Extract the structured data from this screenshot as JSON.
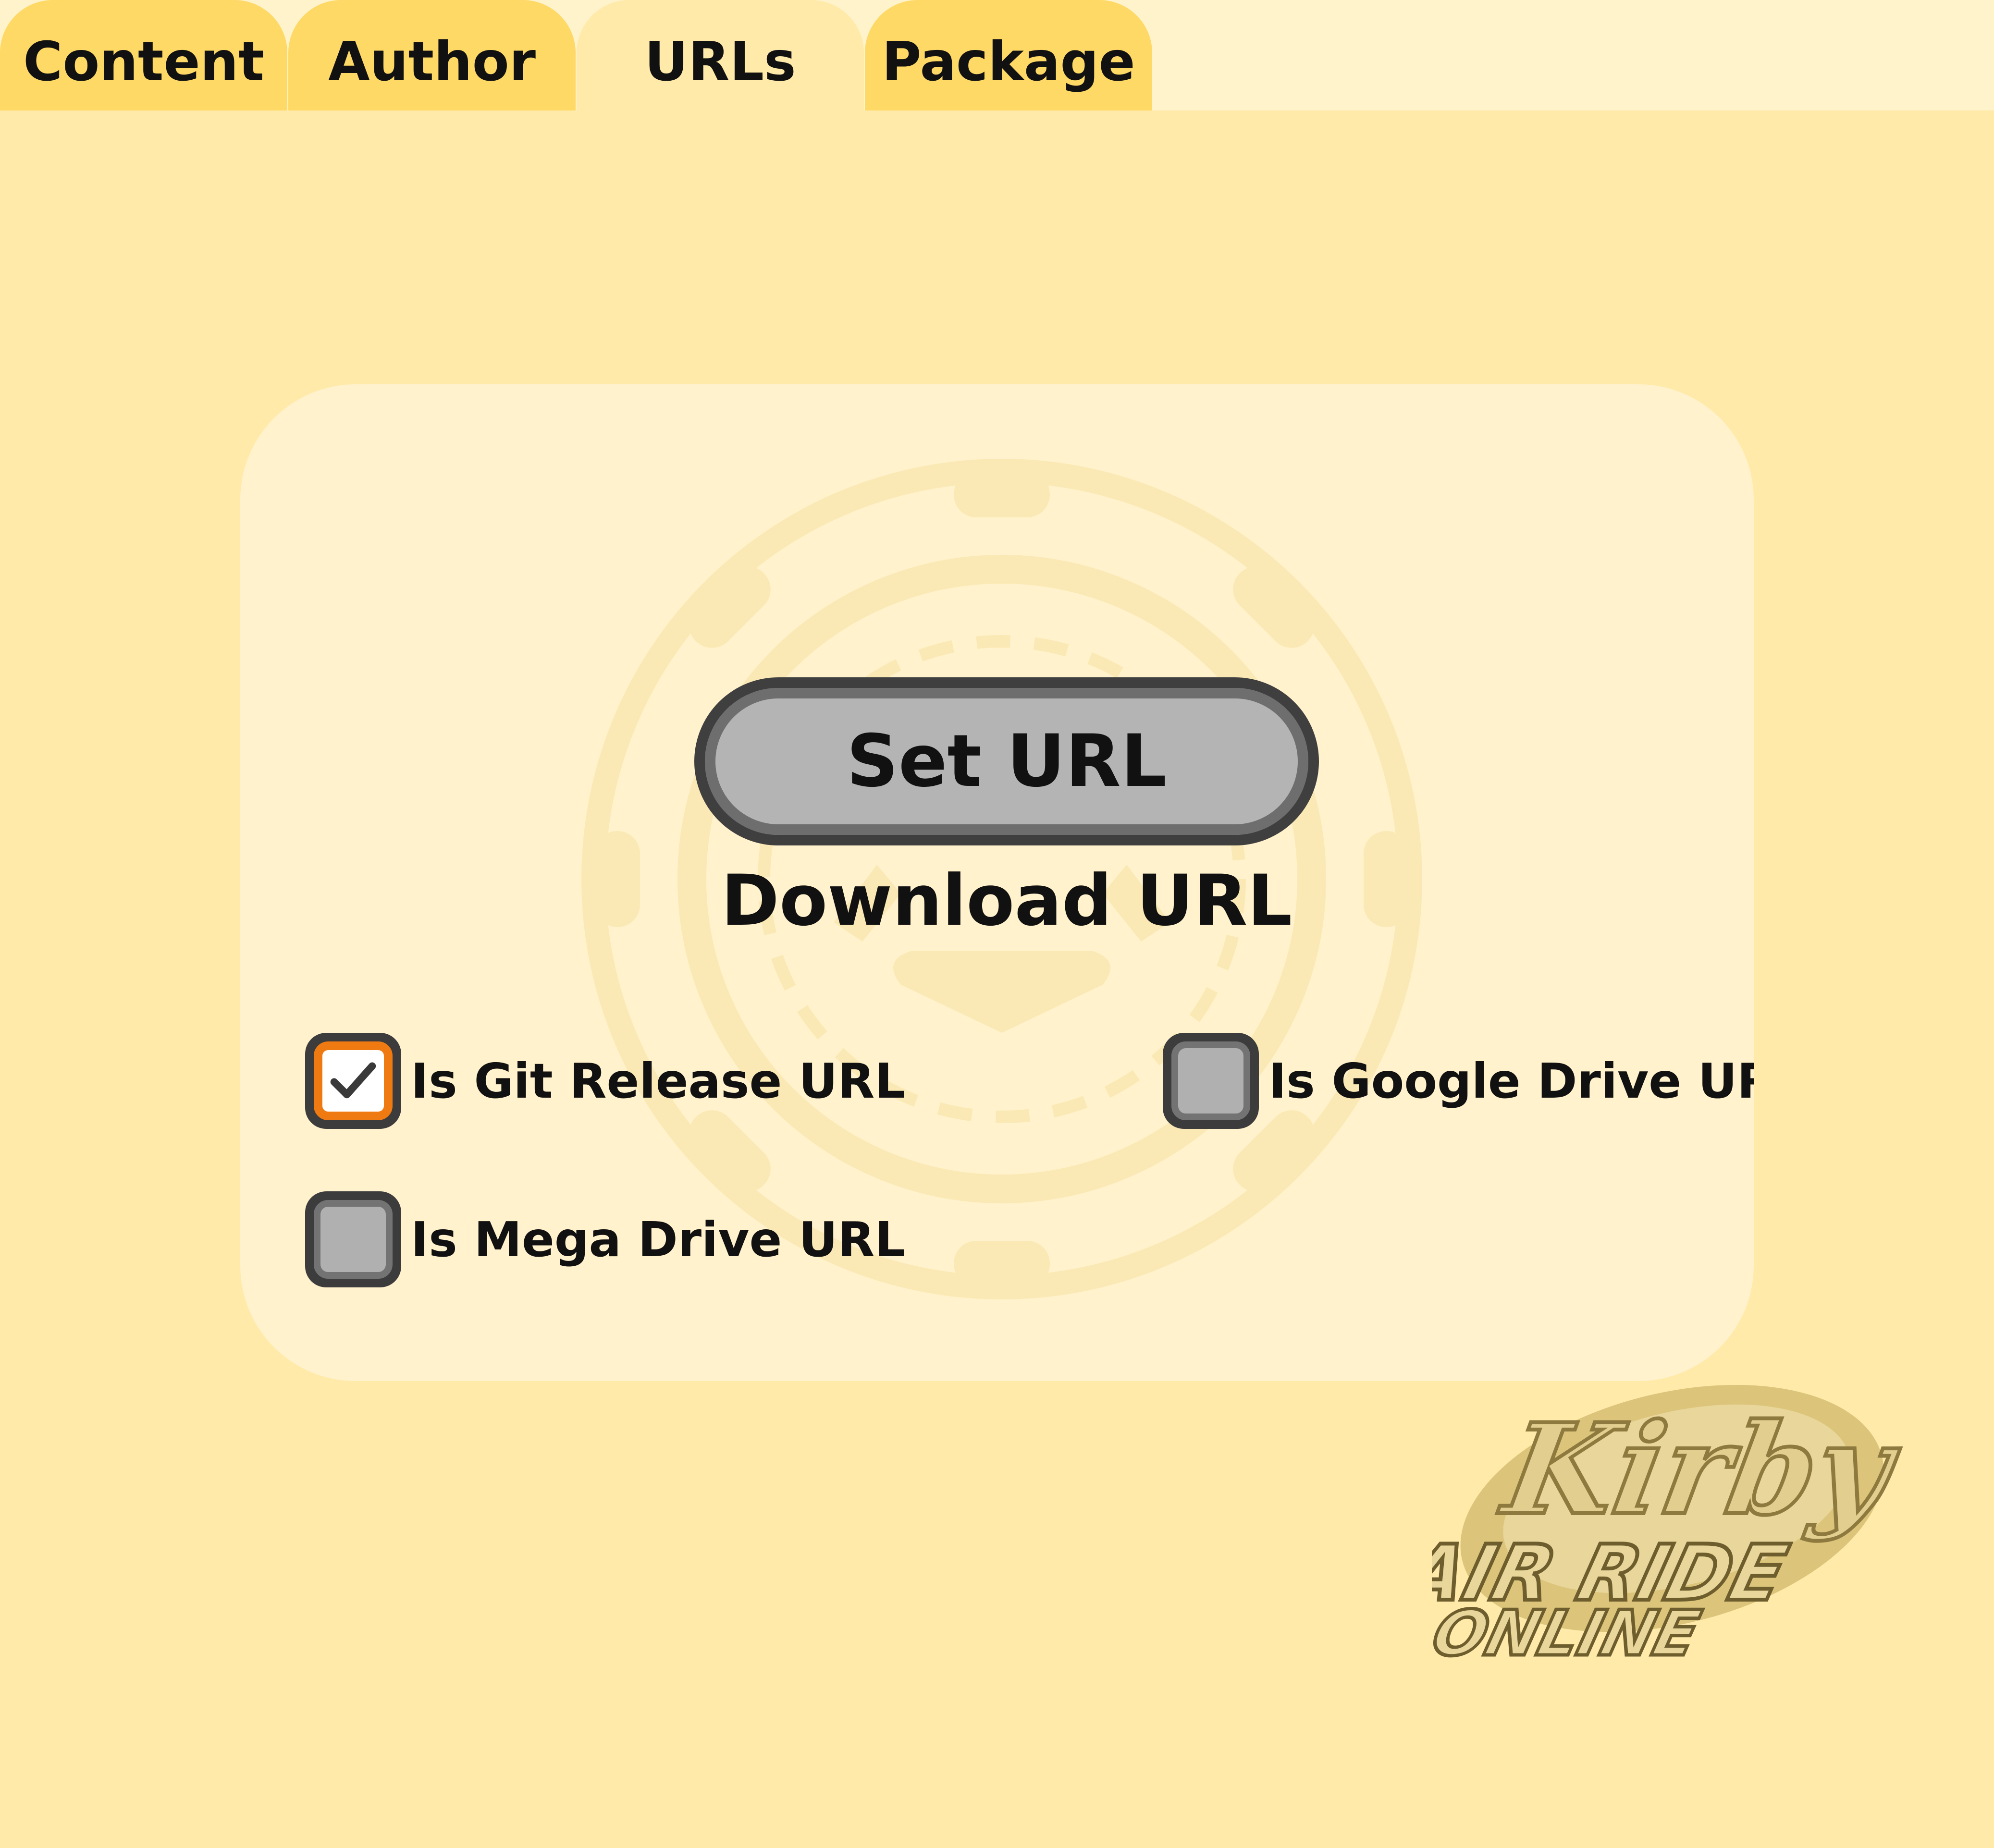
{
  "tabs": [
    {
      "label": "Content",
      "active": false
    },
    {
      "label": "Author",
      "active": false
    },
    {
      "label": "URLs",
      "active": true
    },
    {
      "label": "Package",
      "active": false
    }
  ],
  "main": {
    "set_url_button": "Set URL",
    "download_label": "Download URL"
  },
  "options": {
    "git_release": {
      "label": "Is Git Release URL",
      "checked": true
    },
    "google_drive": {
      "label": "Is Google Drive URL",
      "checked": false
    },
    "mega_drive": {
      "label": "Is Mega Drive URL",
      "checked": false
    }
  },
  "logo": {
    "name": "Kirby Air Ride Online logo",
    "lines": [
      "Kirby",
      "AIR RIDE",
      "ONLINE"
    ]
  },
  "colors": {
    "background": "#FFEAAA",
    "tab_inactive": "#FFD966",
    "tab_active": "#FFEAAA",
    "card": "#FFF2CC",
    "checkbox_accent": "#F07A12",
    "button_fill": "#B4B4B4",
    "button_border": "#3F3F3F"
  },
  "icons": {
    "checkmark": "check-icon",
    "watermark": "wheel-watermark-icon"
  }
}
